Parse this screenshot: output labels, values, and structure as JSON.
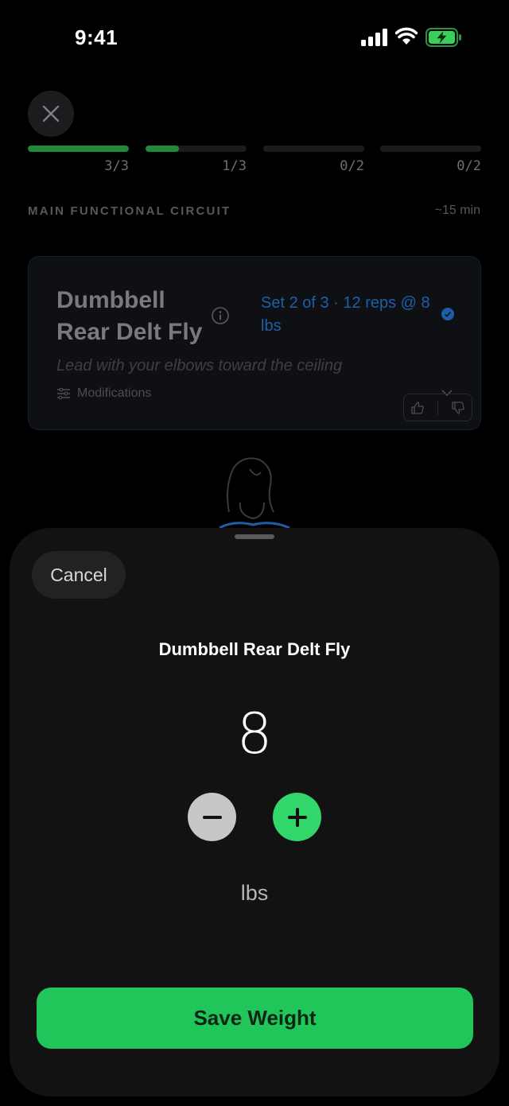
{
  "status_bar": {
    "time": "9:41",
    "icons": [
      "signal-icon",
      "wifi-icon",
      "battery-charging-icon"
    ],
    "battery_color": "#38d05b"
  },
  "workout": {
    "progress": [
      {
        "label": "3/3",
        "fraction": 1.0
      },
      {
        "label": "1/3",
        "fraction": 0.333
      },
      {
        "label": "0/2",
        "fraction": 0
      },
      {
        "label": "0/2",
        "fraction": 0
      }
    ],
    "circuit_title": "MAIN FUNCTIONAL CIRCUIT",
    "circuit_duration": "~15 min",
    "exercise": {
      "name": "Dumbbell Rear Delt Fly",
      "set_info": "Set 2 of 3 · 12 reps @ 8 lbs",
      "cue": "Lead with your elbows toward the ceiling",
      "modifications_label": "Modifications"
    }
  },
  "sheet": {
    "cancel_label": "Cancel",
    "title": "Dumbbell Rear Delt Fly",
    "weight": "8",
    "unit": "lbs",
    "save_label": "Save Weight"
  },
  "colors": {
    "accent_green": "#20c659",
    "plus_green": "#33d66a",
    "progress_green": "#1f8a3c",
    "link_blue": "#1c5fa8"
  }
}
